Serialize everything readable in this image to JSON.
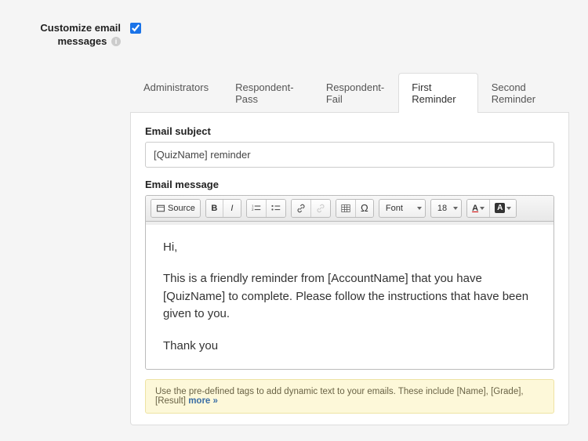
{
  "sidebar": {
    "label": "Customize email messages",
    "checked": true
  },
  "tabs": [
    {
      "label": "Administrators",
      "active": false
    },
    {
      "label": "Respondent-Pass",
      "active": false
    },
    {
      "label": "Respondent-Fail",
      "active": false
    },
    {
      "label": "First Reminder",
      "active": true
    },
    {
      "label": "Second Reminder",
      "active": false
    }
  ],
  "fields": {
    "subject_label": "Email subject",
    "subject_value": "[QuizName] reminder",
    "message_label": "Email message"
  },
  "toolbar": {
    "source": "Source",
    "font_label": "Font",
    "size_label": "18"
  },
  "message_body": {
    "p1": "Hi,",
    "p2": "This is a friendly reminder from [AccountName] that you have [QuizName] to complete. Please follow the instructions that have been given to you.",
    "p3": "Thank you"
  },
  "hint": {
    "text": "Use the pre-defined tags to add dynamic text to your emails. These include [Name], [Grade], [Result] ",
    "more": "more »"
  }
}
